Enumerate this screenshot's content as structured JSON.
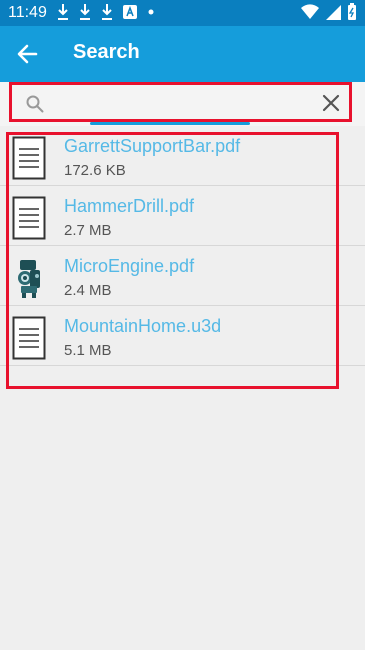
{
  "status_bar": {
    "time": "11:49"
  },
  "app_bar": {
    "title": "Search"
  },
  "search": {
    "value": "",
    "placeholder": ""
  },
  "files": [
    {
      "name": "GarrettSupportBar.pdf",
      "size": "172.6 KB",
      "icon": "document-icon"
    },
    {
      "name": "HammerDrill.pdf",
      "size": "2.7 MB",
      "icon": "document-icon"
    },
    {
      "name": "MicroEngine.pdf",
      "size": "2.4 MB",
      "icon": "engine-thumbnail-icon"
    },
    {
      "name": "MountainHome.u3d",
      "size": "5.1 MB",
      "icon": "document-icon"
    }
  ],
  "colors": {
    "status_bar": "#0a7fbf",
    "app_bar": "#159ddb",
    "file_name": "#55b9e6",
    "highlight": "#e8112d"
  }
}
